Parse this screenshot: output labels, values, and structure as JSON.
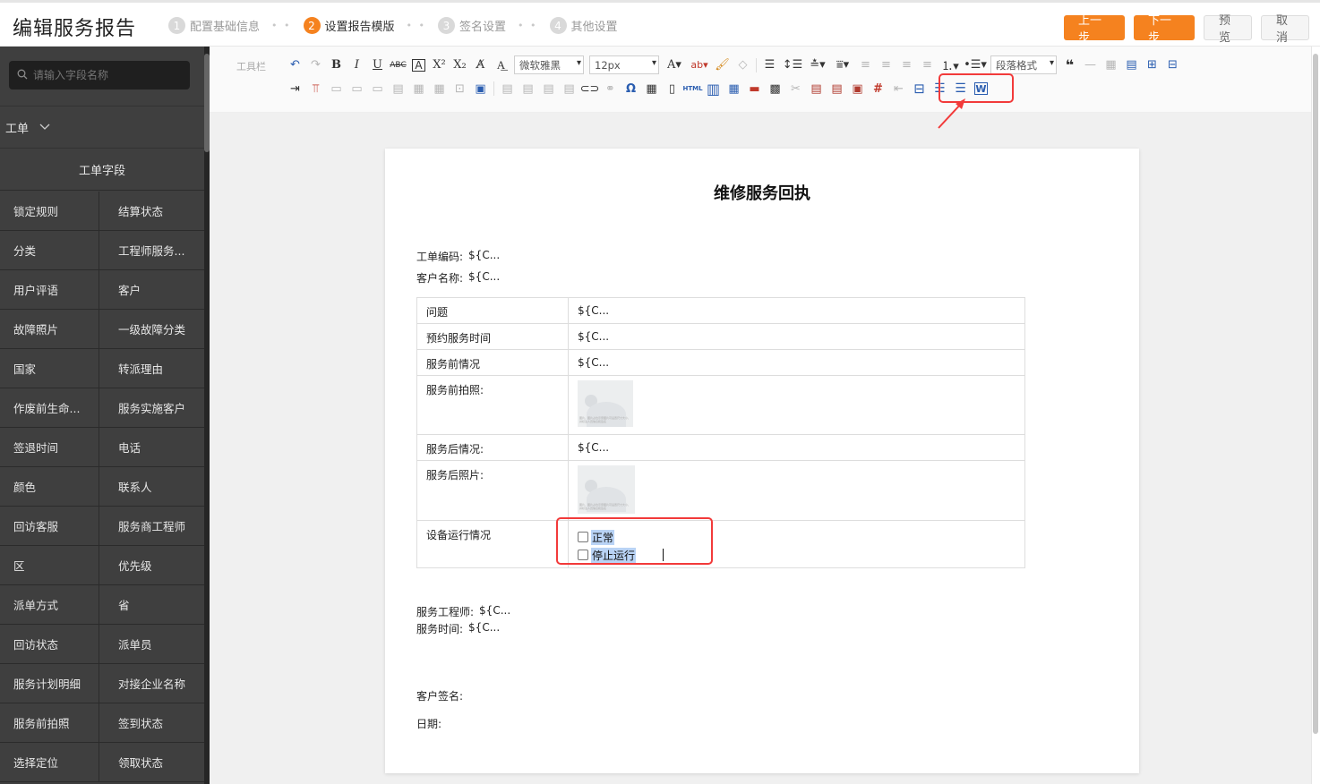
{
  "header": {
    "title": "编辑服务报告",
    "steps": [
      {
        "num": "1",
        "label": "配置基础信息"
      },
      {
        "num": "2",
        "label": "设置报告模版"
      },
      {
        "num": "3",
        "label": "签名设置"
      },
      {
        "num": "4",
        "label": "其他设置"
      }
    ],
    "buttons": {
      "prev": "上一步",
      "next": "下一步",
      "preview": "预览",
      "cancel": "取消"
    },
    "active_step": 2,
    "accent_color": "#f5821f"
  },
  "sidebar": {
    "search_placeholder": "请输入字段名称",
    "category": "工单",
    "section_header": "工单字段",
    "fields": [
      [
        "锁定规则",
        "结算状态"
      ],
      [
        "分类",
        "工程师服务..."
      ],
      [
        "用户评语",
        "客户"
      ],
      [
        "故障照片",
        "一级故障分类"
      ],
      [
        "国家",
        "转派理由"
      ],
      [
        "作废前生命...",
        "服务实施客户"
      ],
      [
        "签退时间",
        "电话"
      ],
      [
        "颜色",
        "联系人"
      ],
      [
        "回访客服",
        "服务商工程师"
      ],
      [
        "区",
        "优先级"
      ],
      [
        "派单方式",
        "省"
      ],
      [
        "回访状态",
        "派单员"
      ],
      [
        "服务计划明细",
        "对接企业名称"
      ],
      [
        "服务前拍照",
        "签到状态"
      ],
      [
        "选择定位",
        "领取状态"
      ]
    ]
  },
  "toolbar": {
    "label": "工具栏",
    "font_family": "微软雅黑",
    "font_size": "12px",
    "paragraph_format": "段落格式",
    "html_label": "HTML"
  },
  "document": {
    "title": "维修服务回执",
    "order_code_label": "工单编码:",
    "order_code_value": "${C...",
    "customer_name_label": "客户名称:",
    "customer_name_value": "${C...",
    "rows": [
      {
        "label": "问题",
        "value": "${C..."
      },
      {
        "label": "预约服务时间",
        "value": "${C..."
      },
      {
        "label": "服务前情况",
        "value": "${C..."
      },
      {
        "label": "服务前拍照:",
        "image_caption": "图片，图片占位示意图片可设置尺寸大小，并标注人员信息和签名"
      },
      {
        "label": "服务后情况:",
        "value": "${C..."
      },
      {
        "label": "服务后照片:",
        "image_caption": "图片，图片占位示意图片可设置尺寸大小，并标注人员信息和签名"
      },
      {
        "label": "设备运行情况",
        "options": [
          "正常",
          "停止运行"
        ]
      }
    ],
    "engineer_label": "服务工程师:",
    "engineer_value": "${C...",
    "service_time_label": "服务时间:",
    "service_time_value": "${C...",
    "customer_sign_label": "客户签名:",
    "date_label": "日期:"
  },
  "annotation_color": "#f23a3a"
}
